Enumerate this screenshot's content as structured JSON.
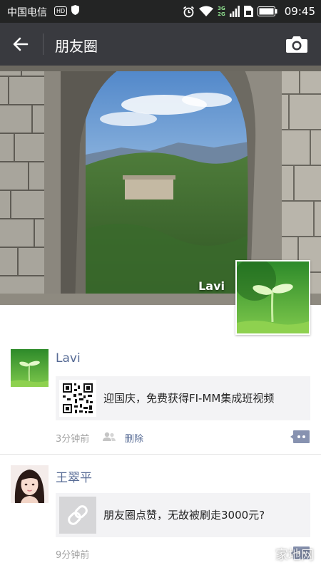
{
  "status_bar": {
    "carrier": "中国电信",
    "hd_badge": "HD",
    "network_labels": [
      "3G",
      "2G"
    ],
    "time": "09:45"
  },
  "header": {
    "title": "朋友圈",
    "back_icon": "arrow-left-icon",
    "camera_icon": "camera-icon"
  },
  "cover": {
    "user_name": "Lavi"
  },
  "posts": [
    {
      "author": "Lavi",
      "link_title": "迎国庆，免费获得FI-MM集成班视频",
      "thumb_icon": "qr-code-icon",
      "time": "3分钟前",
      "delete_label": "删除"
    },
    {
      "author": "王翠平",
      "link_title": "朋友圈点赞，无故被刷走3000元?",
      "thumb_icon": "link-icon",
      "time": "9分钟前"
    }
  ],
  "watermark": "家地网"
}
